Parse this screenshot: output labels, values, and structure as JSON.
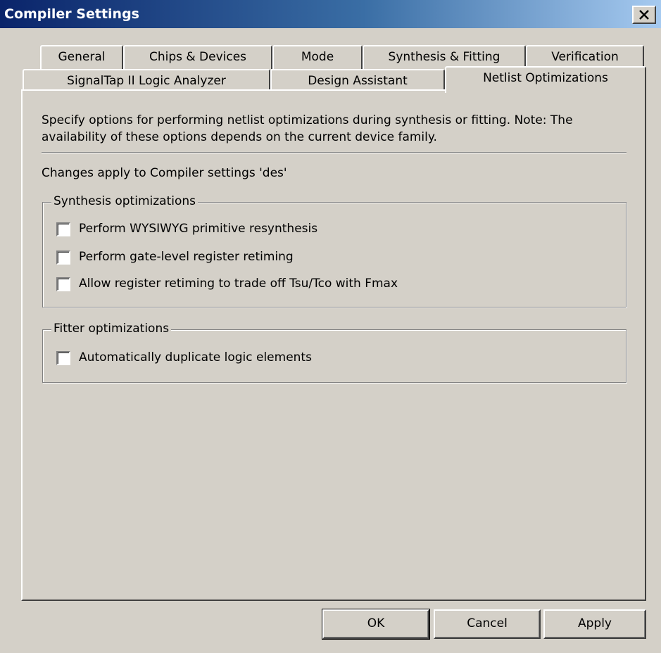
{
  "window": {
    "title": "Compiler Settings",
    "close_symbol": "×"
  },
  "tabs": {
    "row1": [
      "General",
      "Chips & Devices",
      "Mode",
      "Synthesis & Fitting",
      "Verification"
    ],
    "row2": [
      "SignalTap II Logic Analyzer",
      "Design Assistant",
      "Netlist Optimizations"
    ],
    "active": "Netlist Optimizations"
  },
  "panel": {
    "description_line1": "Specify options for performing netlist optimizations during synthesis or fitting. Note: The",
    "description_line2": "availability of these options depends on the current device family.",
    "changes_note": "Changes apply to Compiler settings 'des'",
    "synthesis_group": {
      "label": "Synthesis optimizations",
      "options": [
        {
          "label": "Perform WYSIWYG primitive resynthesis",
          "checked": false
        },
        {
          "label": "Perform gate-level register retiming",
          "checked": false
        },
        {
          "label": "Allow register retiming to trade off Tsu/Tco with Fmax",
          "checked": false
        }
      ]
    },
    "fitter_group": {
      "label": "Fitter optimizations",
      "options": [
        {
          "label": "Automatically duplicate logic elements",
          "checked": false
        }
      ]
    }
  },
  "buttons": {
    "ok": "OK",
    "cancel": "Cancel",
    "apply": "Apply"
  }
}
